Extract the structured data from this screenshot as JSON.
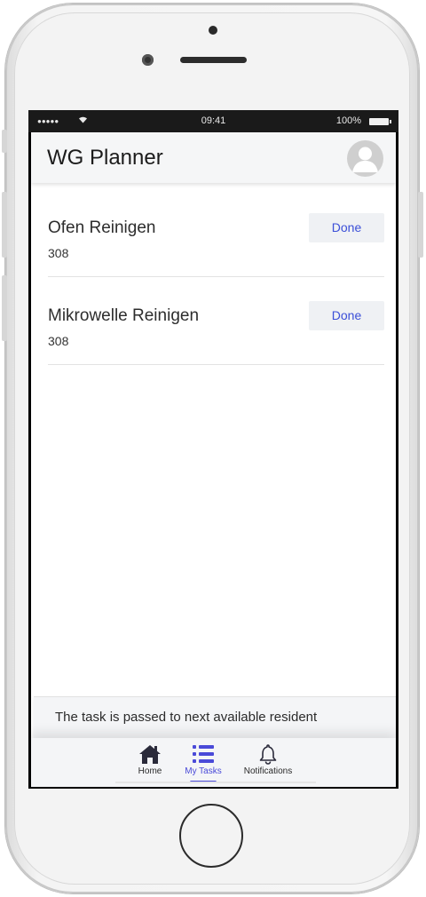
{
  "status_bar": {
    "signal": "●●●●●",
    "time": "09:41",
    "battery_label": "100%"
  },
  "header": {
    "title": "WG Planner"
  },
  "tasks": [
    {
      "title": "Ofen Reinigen",
      "room": "308",
      "action_label": "Done"
    },
    {
      "title": "Mikrowelle Reinigen",
      "room": "308",
      "action_label": "Done"
    }
  ],
  "toast": {
    "message": "The task is passed to next available resident"
  },
  "tabbar": {
    "tabs": [
      {
        "label": "Home",
        "icon": "home-icon",
        "active": false
      },
      {
        "label": "My Tasks",
        "icon": "list-icon",
        "active": true
      },
      {
        "label": "Notifications",
        "icon": "bell-icon",
        "active": false
      }
    ]
  },
  "colors": {
    "accent": "#4a4ad8",
    "done_text": "#3b4fd8",
    "header_bg": "#f5f6f7"
  }
}
